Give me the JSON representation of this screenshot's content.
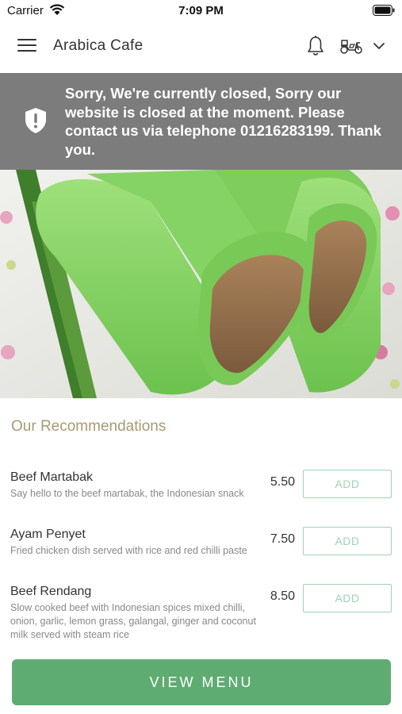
{
  "status_bar": {
    "carrier": "Carrier",
    "time": "7:09 PM"
  },
  "header": {
    "title": "Arabica Cafe",
    "icons": [
      "menu-icon",
      "bell-icon",
      "scooter-icon",
      "chevron-down-icon"
    ]
  },
  "banner": {
    "message": "Sorry, We're currently closed, Sorry our website is closed at the moment. Please contact us via telephone 01216283199. Thank you.",
    "background_color": "#7c7c7c",
    "icon": "shield-alert-icon"
  },
  "recommendations": {
    "title": "Our Recommendations",
    "items": [
      {
        "name": "Beef Martabak",
        "description": "Say hello to the beef martabak, the Indonesian snack",
        "price": "5.50",
        "button_label": "ADD"
      },
      {
        "name": "Ayam Penyet",
        "description": "Fried chicken dish served with rice and red chilli paste",
        "price": "7.50",
        "button_label": "ADD"
      },
      {
        "name": "Beef Rendang",
        "description": "Slow cooked beef with Indonesian spices mixed chilli, onion, garlic, lemon grass, galangal, ginger and coconut milk served with steam rice",
        "price": "8.50",
        "button_label": "ADD"
      }
    ]
  },
  "footer": {
    "view_menu_label": "VIEW MENU",
    "accent_color": "#5fac72"
  }
}
